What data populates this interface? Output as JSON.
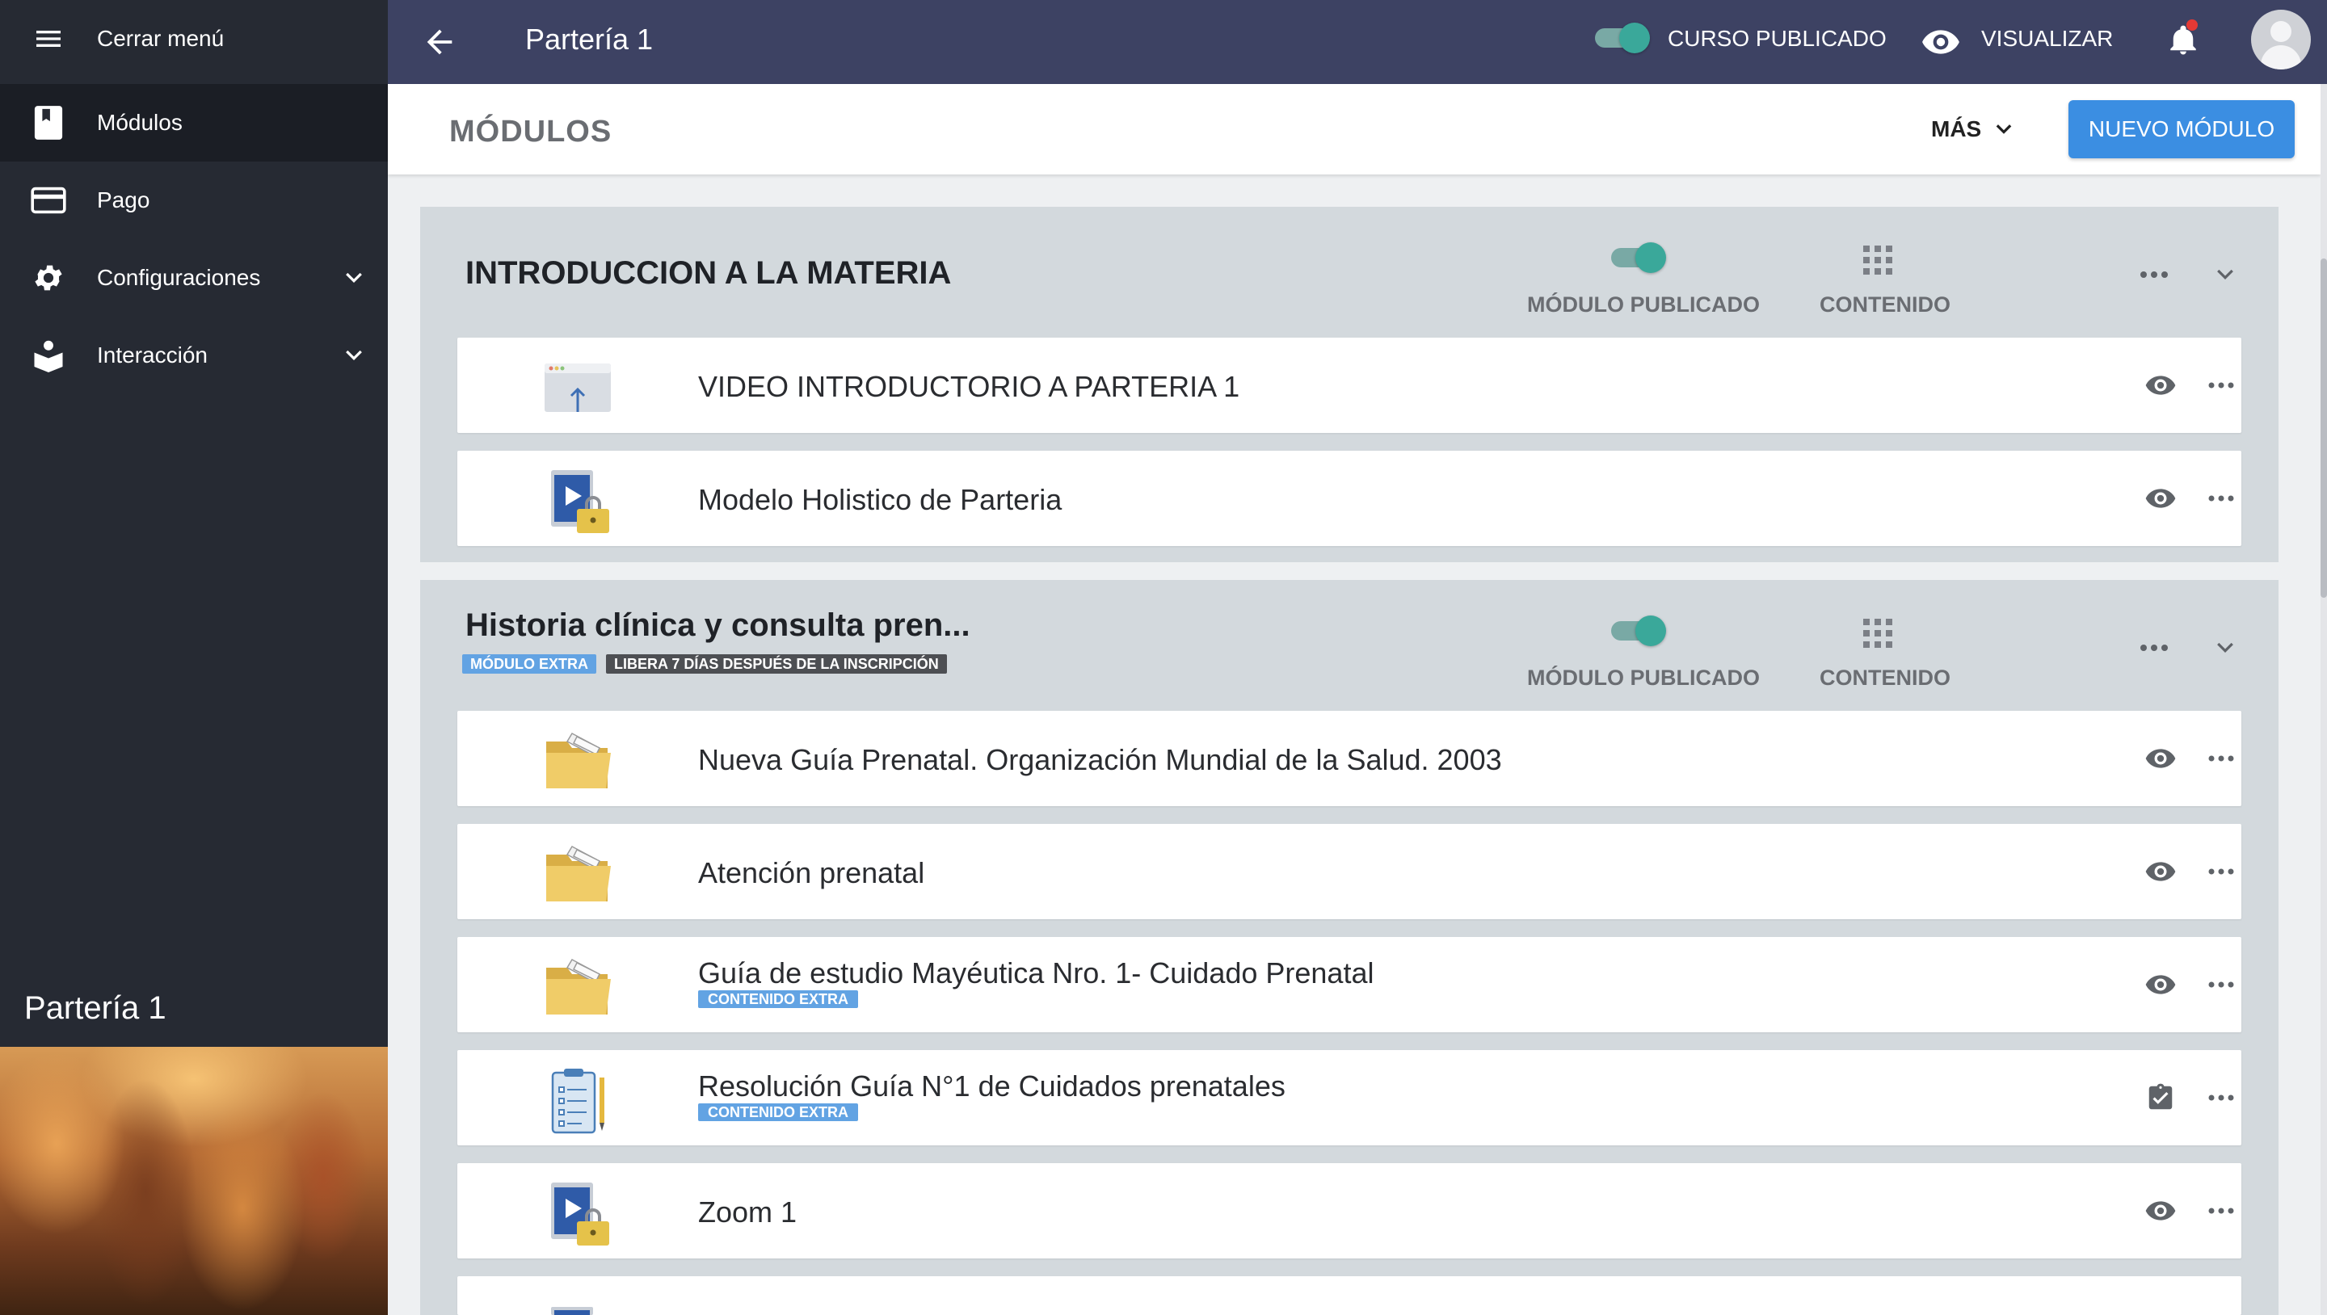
{
  "sidebar": {
    "close_menu": "Cerrar menú",
    "items": [
      {
        "label": "Módulos",
        "icon": "book-icon",
        "active": true
      },
      {
        "label": "Pago",
        "icon": "credit-card-icon"
      },
      {
        "label": "Configuraciones",
        "icon": "gear-icon",
        "expandable": true
      },
      {
        "label": "Interacción",
        "icon": "interaction-icon",
        "expandable": true
      }
    ],
    "course_name": "Partería 1"
  },
  "topbar": {
    "title": "Partería 1",
    "published_label": "CURSO PUBLICADO",
    "published": true,
    "visualize_label": "VISUALIZAR",
    "has_notification": true
  },
  "header": {
    "title": "MÓDULOS",
    "more_label": "MÁS",
    "new_module_label": "NUEVO MÓDULO"
  },
  "colors": {
    "sidebar_bg": "#262a33",
    "topbar_bg": "#3d4263",
    "accent_blue": "#3b8ee2",
    "toggle_on": "#3aa89a",
    "module_bg": "#d3d9dd",
    "badge_blue": "#62a3e3"
  },
  "modules": [
    {
      "title": "INTRODUCCION A LA MATERIA",
      "published_label": "MÓDULO PUBLICADO",
      "content_label": "CONTENIDO",
      "badges": [],
      "items": [
        {
          "title": "VIDEO INTRODUCTORIO A PARTERIA 1",
          "icon": "upload-window-icon",
          "action": "eye-icon"
        },
        {
          "title": "Modelo Holistico de Parteria",
          "icon": "locked-video-icon",
          "action": "eye-icon"
        }
      ]
    },
    {
      "title": "Historia clínica y consulta pren...",
      "published_label": "MÓDULO PUBLICADO",
      "content_label": "CONTENIDO",
      "badges": [
        "MÓDULO EXTRA",
        "LIBERA 7 DÍAS DESPUÉS DE LA INSCRIPCIÓN"
      ],
      "items": [
        {
          "title": "Nueva Guía Prenatal. Organización Mundial de la Salud. 2003",
          "icon": "folder-icon",
          "action": "eye-icon"
        },
        {
          "title": "Atención prenatal",
          "icon": "folder-icon",
          "action": "eye-icon"
        },
        {
          "title": "Guía de estudio Mayéutica Nro. 1- Cuidado Prenatal",
          "icon": "folder-icon",
          "action": "eye-icon",
          "badge": "CONTENIDO EXTRA"
        },
        {
          "title": "Resolución Guía N°1 de Cuidados prenatales",
          "icon": "clipboard-icon",
          "action": "assignment-check-icon",
          "badge": "CONTENIDO EXTRA"
        },
        {
          "title": "Zoom 1",
          "icon": "locked-video-icon",
          "action": "eye-icon"
        }
      ]
    }
  ]
}
